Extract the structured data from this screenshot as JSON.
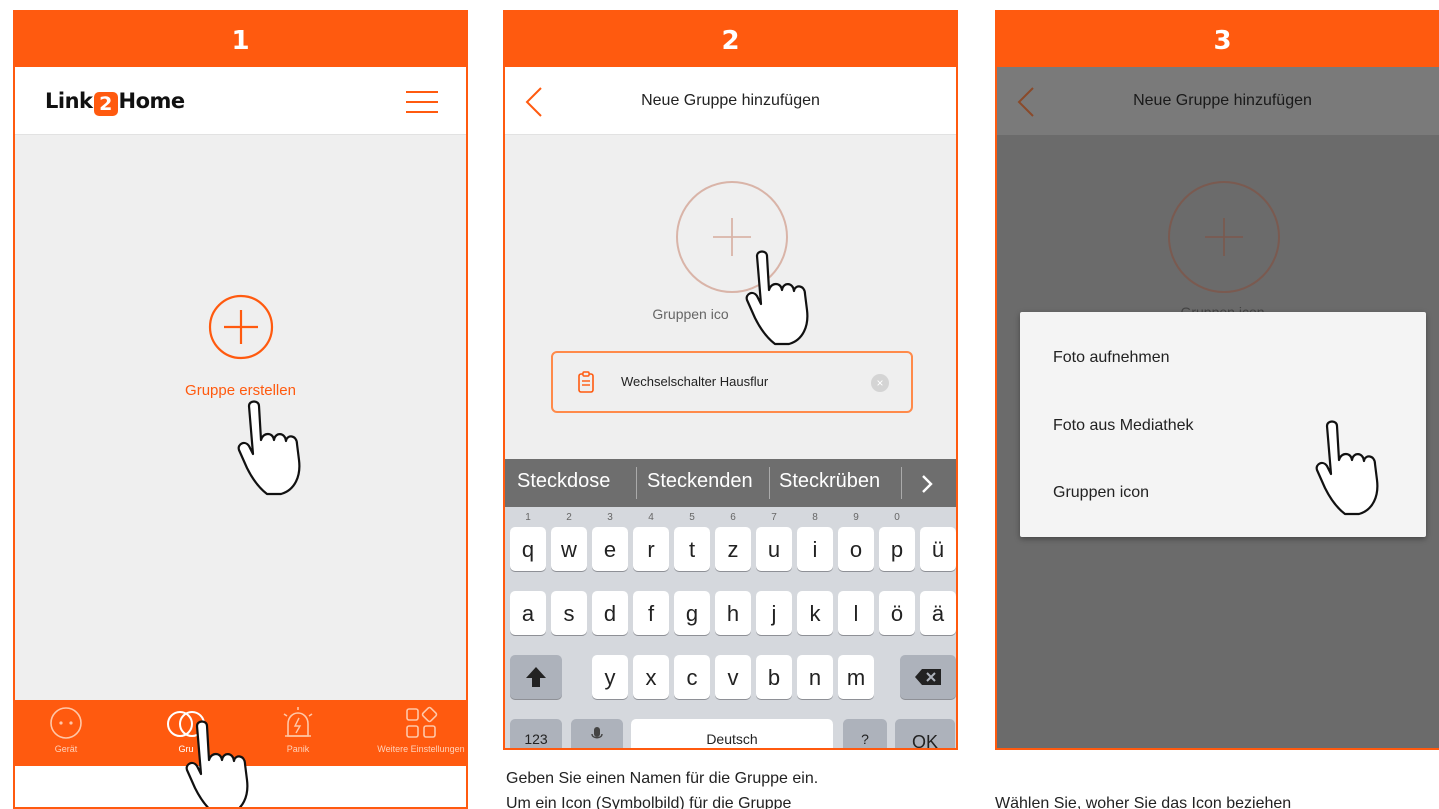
{
  "colors": {
    "accent": "#ff5a0f",
    "overlay": "#6b6b6b",
    "surface": "#efefef"
  },
  "panel1": {
    "step": "1",
    "logo": {
      "part_a": "Link",
      "part_b": "2",
      "part_c": "Home"
    },
    "create_group_label": "Gruppe erstellen",
    "tabs": [
      {
        "icon": "outlet-icon",
        "label": "Gerät"
      },
      {
        "icon": "group-icon",
        "label": "Gru"
      },
      {
        "icon": "alarm-icon",
        "label": "Panik"
      },
      {
        "icon": "grid-icon",
        "label": "Weitere Einstellungen"
      }
    ]
  },
  "panel2": {
    "step": "2",
    "title": "Neue Gruppe hinzufügen",
    "icon_label": "Gruppen ico",
    "group_name_value": "Wechselschalter Hausflur",
    "suggestions": [
      "Steckdose",
      "Steckenden",
      "Steckrüben"
    ],
    "keyboard": {
      "row1": [
        "q",
        "w",
        "e",
        "r",
        "t",
        "z",
        "u",
        "i",
        "o",
        "p",
        "ü"
      ],
      "row1_hints": [
        "1",
        "2",
        "3",
        "4",
        "5",
        "6",
        "7",
        "8",
        "9",
        "0",
        ""
      ],
      "row2": [
        "a",
        "s",
        "d",
        "f",
        "g",
        "h",
        "j",
        "k",
        "l",
        "ö",
        "ä"
      ],
      "row3": [
        "y",
        "x",
        "c",
        "v",
        "b",
        "n",
        "m"
      ],
      "numbers_key": "123",
      "space_key": "Deutsch",
      "ok_key": "OK"
    },
    "caption_line1": "Geben Sie einen Namen für die Gruppe ein.",
    "caption_line2": "Um ein Icon (Symbolbild) für die Gruppe"
  },
  "panel3": {
    "step": "3",
    "title": "Neue Gruppe hinzufügen",
    "icon_label": "Gruppen icon",
    "menu": [
      "Foto aufnehmen",
      "Foto aus Mediathek",
      "Gruppen icon"
    ],
    "caption": "Wählen Sie, woher Sie das Icon beziehen"
  }
}
